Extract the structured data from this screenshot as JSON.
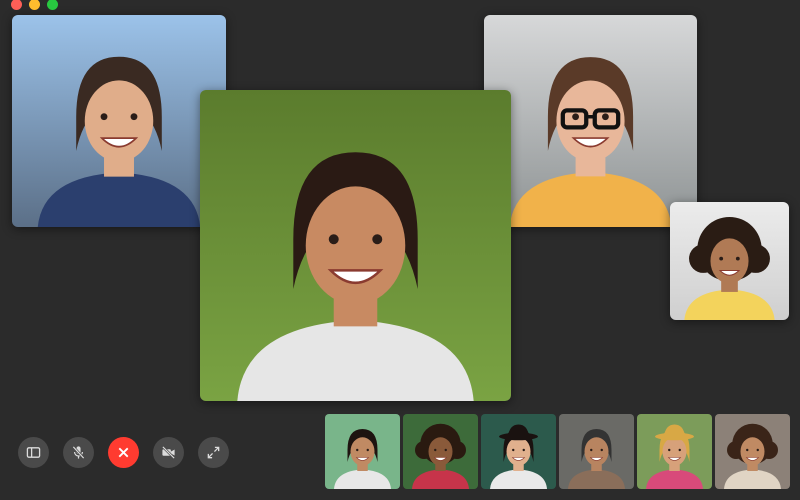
{
  "window": {
    "traffic_lights": {
      "close": "#fe5f57",
      "minimize": "#febc2e",
      "maximize": "#28c840"
    }
  },
  "participants": [
    {
      "id": "p1",
      "skin": "#e0ad8a",
      "hair": "#3a2a22",
      "shirt": "#2b3f6e",
      "bg_top": "#9cc3ea",
      "bg_bottom": "#5b6f87",
      "accent": "#1d3b86"
    },
    {
      "id": "p2",
      "skin": "#c88a62",
      "hair": "#2a1a14",
      "shirt": "#e6e6e6",
      "bg_top": "#5b7c2d",
      "bg_bottom": "#7aa343",
      "accent": "#9bbf62"
    },
    {
      "id": "p3",
      "skin": "#e8b79a",
      "hair": "#5a3a28",
      "shirt": "#f1b24a",
      "bg_top": "#d7d8d9",
      "bg_bottom": "#8e9394",
      "accent": "#1b1b1b"
    },
    {
      "id": "p4",
      "skin": "#b07a55",
      "hair": "#2a1c14",
      "shirt": "#f3d35c",
      "bg_top": "#ececec",
      "bg_bottom": "#cfcfcf",
      "accent": "#e8c24a"
    }
  ],
  "thumbnails": [
    {
      "id": "t1",
      "skin": "#c08a63",
      "hair": "#1e1410",
      "shirt": "#e7e7e7",
      "bg": "#79b58a"
    },
    {
      "id": "t2",
      "skin": "#8a5a3a",
      "hair": "#2a1a10",
      "shirt": "#c7344a",
      "bg": "#3d6b3a"
    },
    {
      "id": "t3",
      "skin": "#e0b08d",
      "hair": "#1a1210",
      "shirt": "#e9e9e9",
      "bg": "#2c5a4c"
    },
    {
      "id": "t4",
      "skin": "#b88460",
      "hair": "#333333",
      "shirt": "#8a6e5a",
      "bg": "#6a6a66"
    },
    {
      "id": "t5",
      "skin": "#d7a17a",
      "hair": "#d8a845",
      "shirt": "#d84a7a",
      "bg": "#7c9c5a"
    },
    {
      "id": "t6",
      "skin": "#c08a63",
      "hair": "#3a2418",
      "shirt": "#e0d4c4",
      "bg": "#8c8178"
    }
  ],
  "controls": [
    {
      "key": "sidebar",
      "icon": "sidebar-icon"
    },
    {
      "key": "mute",
      "icon": "microphone-slash-icon"
    },
    {
      "key": "end",
      "icon": "end-call-icon",
      "color": "#ff3b30"
    },
    {
      "key": "camera",
      "icon": "camera-slash-icon"
    },
    {
      "key": "fullscreen",
      "icon": "fullscreen-icon"
    }
  ]
}
